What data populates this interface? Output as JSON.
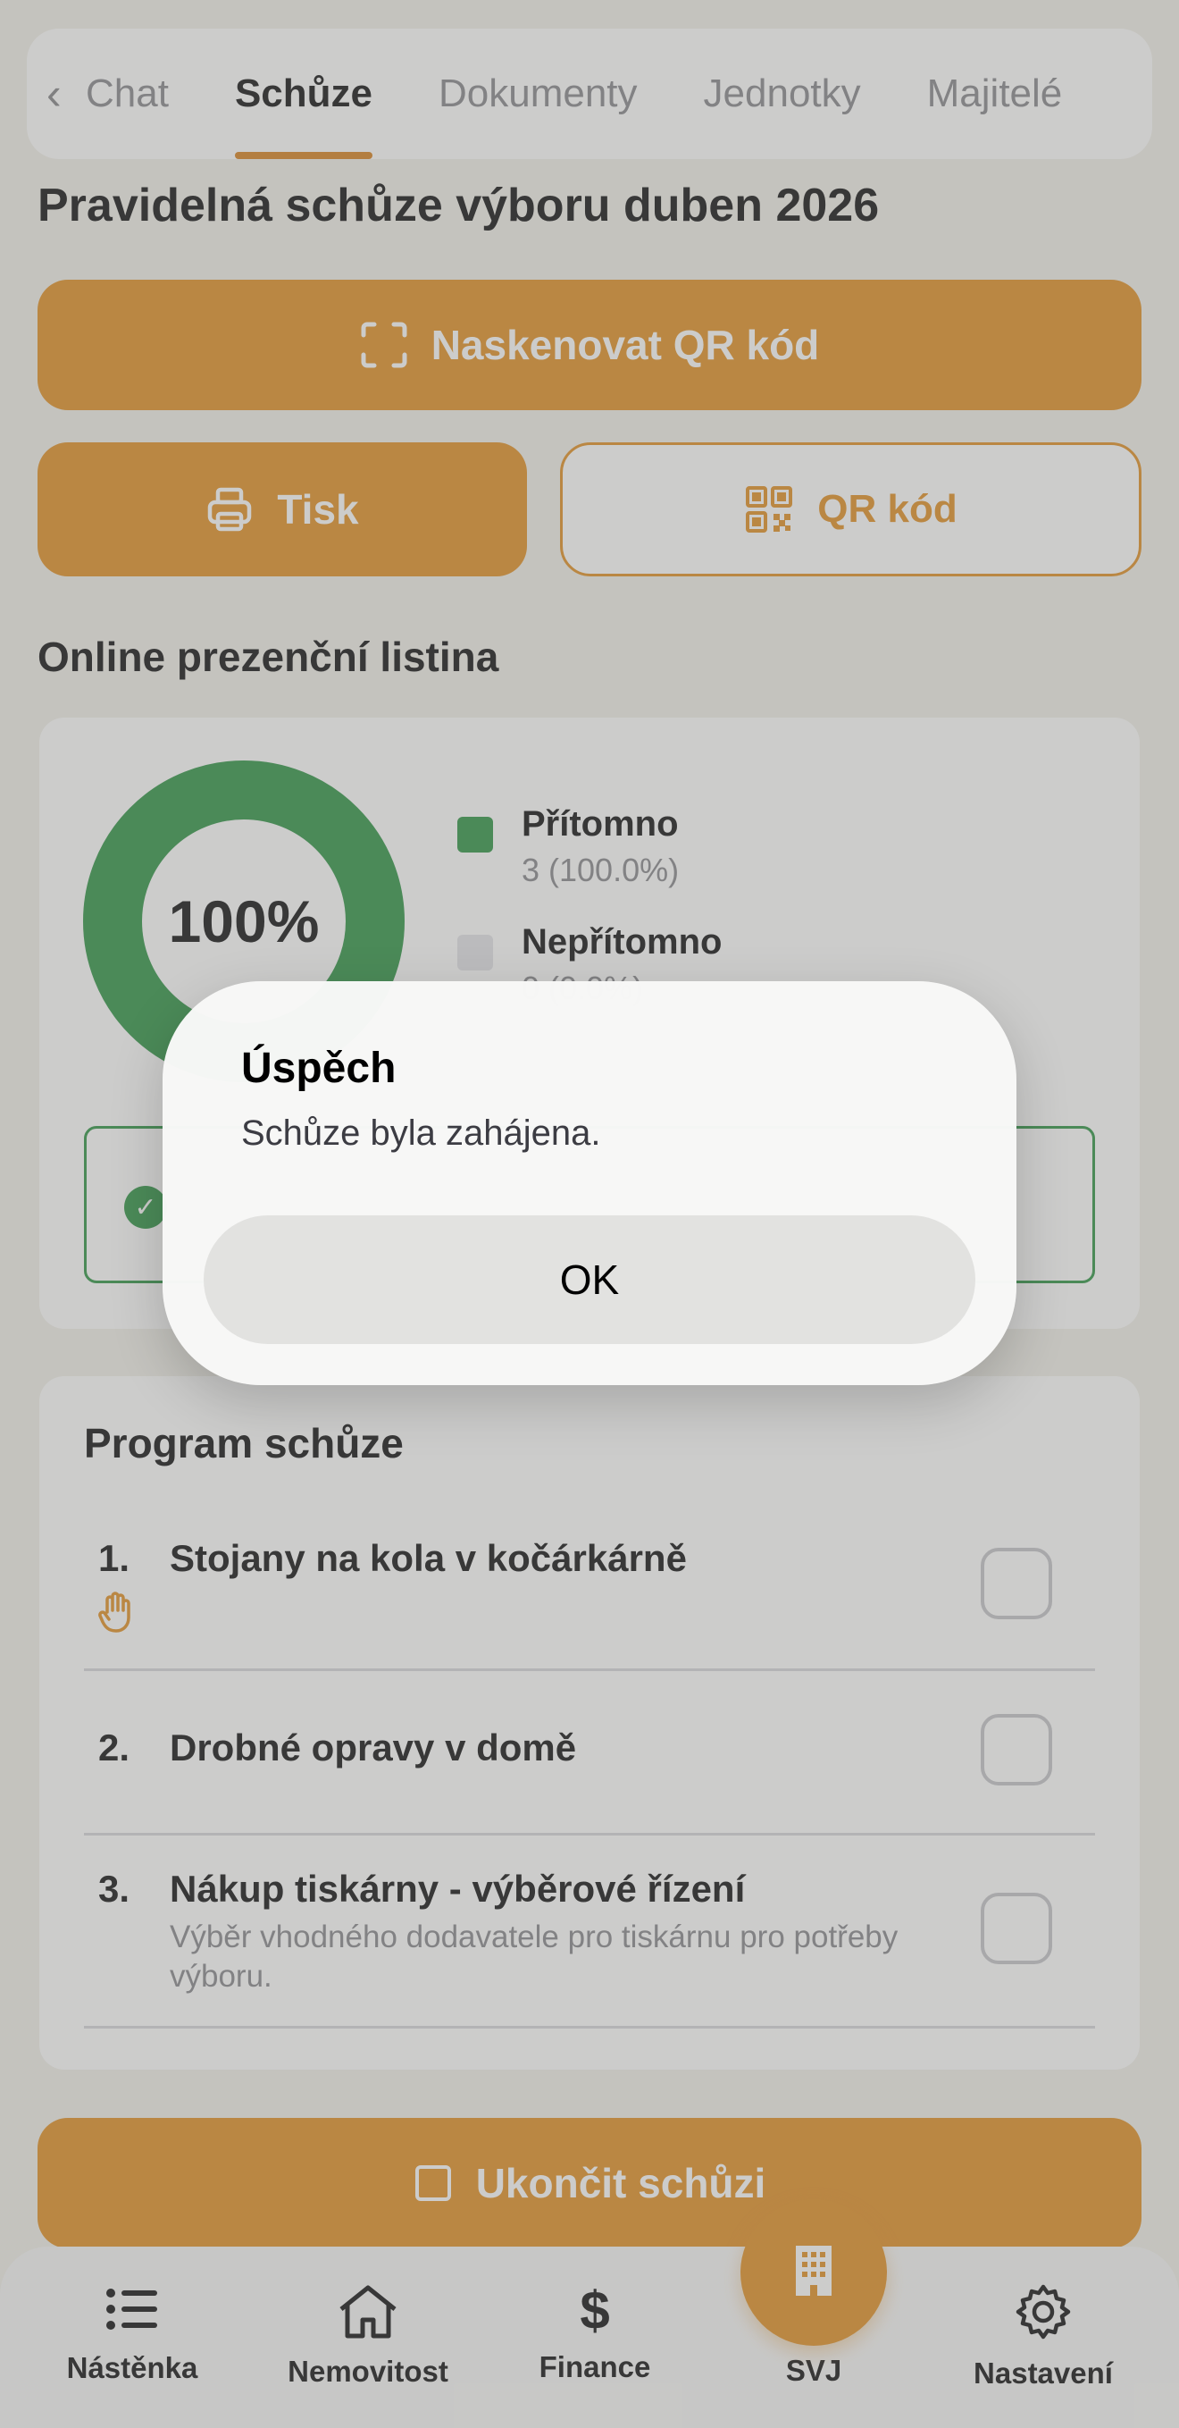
{
  "tabs": {
    "back_label": "‹",
    "items": [
      {
        "label": "Chat"
      },
      {
        "label": "Schůze"
      },
      {
        "label": "Dokumenty"
      },
      {
        "label": "Jednotky"
      },
      {
        "label": "Majitelé"
      }
    ],
    "active": "Schůze"
  },
  "meeting": {
    "title": "Pravidelná schůze výboru duben 2026",
    "scan_label": "Naskenovat QR kód",
    "print_label": "Tisk",
    "qr_label": "QR kód"
  },
  "attendance": {
    "section_title": "Online prezenční listina",
    "percent_label": "100%",
    "present_fraction": 1.0,
    "present_label": "Přítomno",
    "present_value": "3 (100.0%)",
    "absent_label": "Nepřítomno",
    "absent_value": "0 (0.0%)"
  },
  "program": {
    "title": "Program schůze",
    "items": [
      {
        "num": "1.",
        "text": "Stojany na kola v kočárkárně",
        "desc": ""
      },
      {
        "num": "2.",
        "text": "Drobné opravy v domě",
        "desc": ""
      },
      {
        "num": "3.",
        "text": "Nákup tiskárny - výběrové řízení",
        "desc": "Výběr vhodného dodavatele pro tiskárnu pro potřeby výboru."
      }
    ],
    "end_label": "Ukončit schůzi"
  },
  "nav": {
    "items": [
      {
        "label": "Nástěnka",
        "icon": "list-icon"
      },
      {
        "label": "Nemovitost",
        "icon": "house-icon"
      },
      {
        "label": "Finance",
        "icon": "dollar-icon"
      },
      {
        "label": "SVJ",
        "icon": "building-icon"
      },
      {
        "label": "Nastavení",
        "icon": "gear-icon"
      }
    ]
  },
  "dialog": {
    "title": "Úspěch",
    "message": "Schůze byla zahájena.",
    "ok_label": "OK"
  },
  "colors": {
    "accent": "#e3952f",
    "present": "#3a9a4f",
    "absent": "#e5e5ea"
  }
}
